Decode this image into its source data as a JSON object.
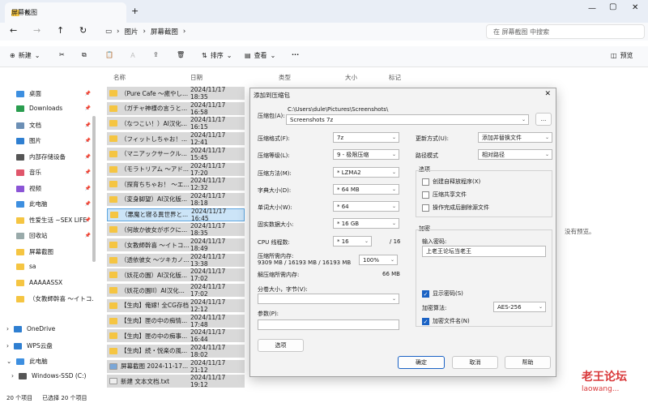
{
  "window": {
    "tab_title": "屏幕截图",
    "new_tab": "+"
  },
  "address": {
    "parts": [
      "图片",
      "屏幕截图"
    ],
    "search_placeholder": "在 屏幕截图 中搜索"
  },
  "toolbar": {
    "new": "新建",
    "sort": "排序",
    "view": "查看",
    "more": "···",
    "details": "预览"
  },
  "sidebar": {
    "items": [
      {
        "label": "桌面",
        "icon": "desktop-icon",
        "pin": true
      },
      {
        "label": "Downloads",
        "icon": "download-icon",
        "pin": true
      },
      {
        "label": "文档",
        "icon": "document-icon",
        "pin": true
      },
      {
        "label": "图片",
        "icon": "pictures-icon",
        "pin": true
      },
      {
        "label": "内部存储设备",
        "icon": "drive-icon",
        "pin": true
      },
      {
        "label": "音乐",
        "icon": "music-icon",
        "pin": true
      },
      {
        "label": "视频",
        "icon": "video-icon",
        "pin": true
      },
      {
        "label": "此电脑",
        "icon": "pc-icon",
        "pin": true
      },
      {
        "label": "性爱生活 ~SEX LIFE",
        "icon": "folder-icon",
        "pin": true
      },
      {
        "label": "回收站",
        "icon": "recycle-bin-icon",
        "pin": true
      },
      {
        "label": "屏幕截图",
        "icon": "folder-icon",
        "pin": false
      },
      {
        "label": "sa",
        "icon": "folder-icon",
        "pin": false
      },
      {
        "label": "AAAAASSX",
        "icon": "folder-icon",
        "pin": false
      },
      {
        "label": "（女教師幹喜 ～イトコ...",
        "icon": "folder-icon",
        "pin": false
      }
    ],
    "drives": [
      {
        "label": "OneDrive",
        "icon": "cloud-icon"
      },
      {
        "label": "WPS云盘",
        "icon": "cloud-icon"
      },
      {
        "label": "此电脑",
        "icon": "pc-icon"
      },
      {
        "label": "Windows-SSD (C:)",
        "icon": "drive-icon"
      }
    ]
  },
  "columns": {
    "name": "名称",
    "date": "日期",
    "type": "类型",
    "size": "大小",
    "tags": "标记"
  },
  "files": [
    {
      "name": "（Pure Cafe ～癒やし...",
      "date": "2024/11/17 18:35"
    },
    {
      "name": "（ガチャ神様の言うと...",
      "date": "2024/11/17 16:58"
    },
    {
      "name": "（なつこい！）AI汉化...",
      "date": "2024/11/17 16:15"
    },
    {
      "name": "（フィットしちゃお！...",
      "date": "2024/11/17 12:41"
    },
    {
      "name": "（マニアックサークル...",
      "date": "2024/11/17 15:45"
    },
    {
      "name": "（モラトリアム ～アド...",
      "date": "2024/11/17 17:20"
    },
    {
      "name": "（探育ちちゃお！ ～エ...",
      "date": "2024/11/17 12:32"
    },
    {
      "name": "（変身脚望）AI汉化版...",
      "date": "2024/11/17 18:18"
    },
    {
      "name": "（悪魔と寝る異世界と...",
      "date": "2024/11/17 16:45"
    },
    {
      "name": "（何故か彼女がボクに...",
      "date": "2024/11/17 18:35"
    },
    {
      "name": "（女教師幹喜 ～イトコ...",
      "date": "2024/11/17 18:49"
    },
    {
      "name": "（透依彼女 ～ツキカノ...",
      "date": "2024/11/17 13:38"
    },
    {
      "name": "（妖花の園）AI汉化版...",
      "date": "2024/11/17 17:02"
    },
    {
      "name": "（妖花の園II）AI汉化...",
      "date": "2024/11/17 17:02"
    },
    {
      "name": "【生肉】俺嫁! 全CG存档",
      "date": "2024/11/17 12:12"
    },
    {
      "name": "【生肉】匣の中の痴情...",
      "date": "2024/11/17 17:48"
    },
    {
      "name": "【生肉】匣の中の痴事...",
      "date": "2024/11/17 16:44"
    },
    {
      "name": "【生肉】続・悦楽の風...",
      "date": "2024/11/17 18:02"
    },
    {
      "name": "屏幕截图 2024-11-17...",
      "date": "2024/11/17 21:12"
    },
    {
      "name": "新建 文本文档.txt",
      "date": "2024/11/17 19:12"
    }
  ],
  "preview_text": "没有预览。",
  "status": {
    "count": "20 个项目",
    "selected": "已选择 20 个项目"
  },
  "dialog": {
    "title": "添加到压缩包",
    "archive_label": "压缩包(A):",
    "archive_path": "C:\\Users\\dule\\Pictures\\Screenshots\\",
    "archive_name": "Screenshots 7z",
    "browse": "...",
    "format_label": "压缩格式(F):",
    "format": "7z",
    "level_label": "压缩等级(L):",
    "level": "9 - 极限压缩",
    "method_label": "压缩方法(M):",
    "method": "* LZMA2",
    "dict_label": "字典大小(D):",
    "dict": "* 64 MB",
    "word_label": "单词大小(W):",
    "word": "* 64",
    "solid_label": "固实数据大小:",
    "solid": "* 16 GB",
    "threads_label": "CPU 线程数:",
    "threads": "* 16",
    "threads_max": "/ 16",
    "mem_label": "压缩所需内存:",
    "mem_value": "9309 MB / 16193 MB / 16193 MB",
    "mem_pct": "100%",
    "decomp_label": "解压缩所需内存:",
    "decomp_value": "66 MB",
    "split_label": "分卷大小，字节(V):",
    "params_label": "参数(P):",
    "options_button": "选项",
    "update_label": "更新方式(U):",
    "update": "添加并替换文件",
    "path_label": "路径模式",
    "path_mode": "相对路径",
    "options_group": "选项",
    "opt_sfx": "创建自释放程序(X)",
    "opt_shared": "压缩共享文件",
    "opt_delete": "操作完成后删除源文件",
    "encrypt_group": "加密",
    "pwd_label": "输入密码:",
    "pwd_value": "上老王论坛当老王",
    "show_pwd": "显示密码(S)",
    "enc_method_label": "加密算法:",
    "enc_method": "AES-256",
    "enc_names": "加密文件名(N)",
    "ok": "确定",
    "cancel": "取消",
    "help": "帮助"
  },
  "watermark": {
    "line1": "老王论坛",
    "line2": "laowang..."
  }
}
